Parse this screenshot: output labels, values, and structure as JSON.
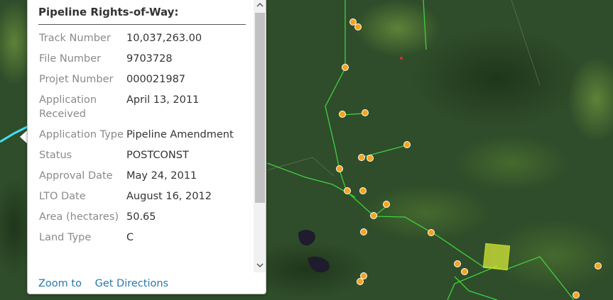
{
  "popup": {
    "title": "Pipeline Rights-of-Way:",
    "fields": [
      {
        "label": "Track Number",
        "value": "10,037,263.00"
      },
      {
        "label": "File Number",
        "value": "9703728"
      },
      {
        "label": "Projet Number",
        "value": "000021987"
      },
      {
        "label": "Application Received",
        "value": "April 13, 2011"
      },
      {
        "label": "Application Type",
        "value": "Pipeline Amendment"
      },
      {
        "label": "Status",
        "value": "POSTCONST"
      },
      {
        "label": "Approval Date",
        "value": "May 24, 2011"
      },
      {
        "label": "LTO Date",
        "value": "August 16, 2012"
      },
      {
        "label": "Area (hectares)",
        "value": "50.65"
      },
      {
        "label": "Land Type",
        "value": "C"
      }
    ],
    "actions": {
      "zoom_to": "Zoom to",
      "directions": "Get Directions"
    }
  },
  "map": {
    "colors": {
      "forest": "#2c4a26",
      "pipeline": "#3fd13f",
      "well": "#f7a41d",
      "selected_parcel": "#d6e83a",
      "highlight_line": "#3ee0f0"
    },
    "icons": {
      "scroll_up": "chevron-up-icon",
      "scroll_down": "chevron-down-icon"
    }
  }
}
